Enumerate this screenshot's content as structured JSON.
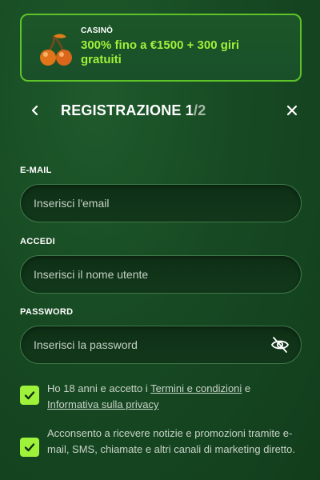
{
  "promo": {
    "label": "CASINÒ",
    "text": "300% fino a €1500 + 300 giri gratuiti",
    "icon": "cherry-icon"
  },
  "header": {
    "title_main": "REGISTRAZIONE 1",
    "title_total": "/2",
    "back_icon": "chevron-left-icon",
    "close_icon": "close-icon"
  },
  "form": {
    "email": {
      "label": "E-MAIL",
      "placeholder": "Inserisci l'email",
      "value": ""
    },
    "username": {
      "label": "ACCEDI",
      "placeholder": "Inserisci il nome utente",
      "value": ""
    },
    "password": {
      "label": "PASSWORD",
      "placeholder": "Inserisci la password",
      "value": "",
      "toggle_icon": "eye-slash-icon"
    }
  },
  "consents": {
    "terms": {
      "checked": true,
      "text_before": "Ho 18 anni e accetto i ",
      "link_terms": "Termini e condizioni",
      "text_middle": " e ",
      "link_privacy": "Informativa sulla privacy"
    },
    "marketing": {
      "checked": true,
      "text": "Acconsento a ricevere notizie e promozioni tramite e-mail, SMS, chiamate e altri canali di marketing diretto."
    }
  },
  "colors": {
    "accent": "#9ef23a",
    "background": "#174a23",
    "promo_border": "#5fc42a"
  }
}
